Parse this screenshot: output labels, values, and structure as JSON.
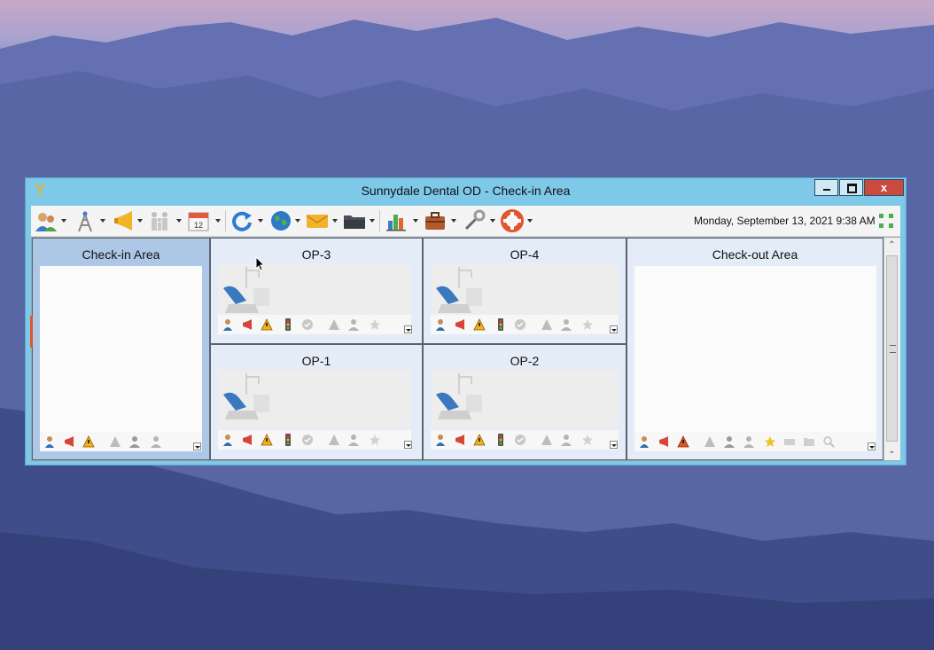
{
  "window": {
    "title": "Sunnydale Dental OD - Check-in Area",
    "close_label": "x"
  },
  "toolbar": {
    "icons": [
      "patients-icon",
      "tower-icon",
      "megaphone-icon",
      "family-icon",
      "calendar-icon",
      "refresh-icon",
      "globe-icon",
      "mail-icon",
      "folder-icon",
      "chart-icon",
      "briefcase-icon",
      "tools-icon",
      "lifebuoy-icon"
    ],
    "calendar_day": "12",
    "datetime": "Monday, September 13, 2021 9:38 AM"
  },
  "panels": {
    "checkin": {
      "title": "Check-in Area"
    },
    "op3": {
      "title": "OP-3"
    },
    "op4": {
      "title": "OP-4"
    },
    "op1": {
      "title": "OP-1"
    },
    "op2": {
      "title": "OP-2"
    },
    "checkout": {
      "title": "Check-out Area"
    }
  },
  "status_icons": [
    "patient-icon",
    "megaphone-icon",
    "warning-icon",
    "traffic-light-icon",
    "check-circle-icon",
    "alert-icon",
    "user-icon",
    "star-icon"
  ],
  "colors": {
    "window_frame": "#7ec8e8",
    "close_button": "#c94a3e",
    "checkin_selected": "#adc8e6",
    "op_header": "#e4ecf8"
  }
}
